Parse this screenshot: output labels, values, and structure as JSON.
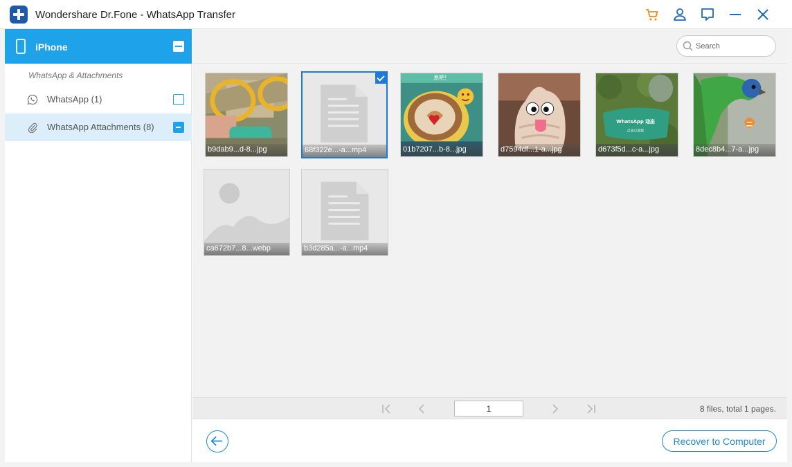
{
  "window": {
    "title": "Wondershare Dr.Fone - WhatsApp Transfer",
    "icons": [
      "cart-icon",
      "account-icon",
      "feedback-icon",
      "minimize-icon",
      "close-icon"
    ],
    "accent": "#1ea3ea"
  },
  "sidebar": {
    "device_name": "iPhone",
    "section_label": "WhatsApp & Attachments",
    "items": [
      {
        "label": "WhatsApp (1)",
        "icon": "whatsapp-icon",
        "checked": false
      },
      {
        "label": "WhatsApp Attachments (8)",
        "icon": "attachment-icon",
        "checked": "partial"
      }
    ]
  },
  "search": {
    "placeholder": "Search"
  },
  "files": [
    {
      "caption": "b9dab9...d-8...jpg",
      "kind": "photo-sunglasses",
      "selected": false
    },
    {
      "caption": "68f322e...-a...mp4",
      "kind": "document",
      "selected": true
    },
    {
      "caption": "01b7207...b-8...jpg",
      "kind": "photo-latte",
      "selected": false
    },
    {
      "caption": "d7594df...1-a...jpg",
      "kind": "photo-icecream",
      "selected": false
    },
    {
      "caption": "d673f5d...c-a...jpg",
      "kind": "photo-whatsapp-card",
      "selected": false
    },
    {
      "caption": "8dec8b4...7-a...jpg",
      "kind": "photo-parrot",
      "selected": false
    },
    {
      "caption": "ca672b7...8...webp",
      "kind": "image-placeholder",
      "selected": false
    },
    {
      "caption": "b3d285a...-a...mp4",
      "kind": "document",
      "selected": false
    }
  ],
  "thumb_texts": {
    "latte_banner": "息吧！",
    "card_title": "WhatsApp 动态",
    "card_sub": "点击以继续"
  },
  "pager": {
    "current_page": "1",
    "status": "8 files, total 1 pages."
  },
  "footer": {
    "recover_label": "Recover to Computer"
  }
}
